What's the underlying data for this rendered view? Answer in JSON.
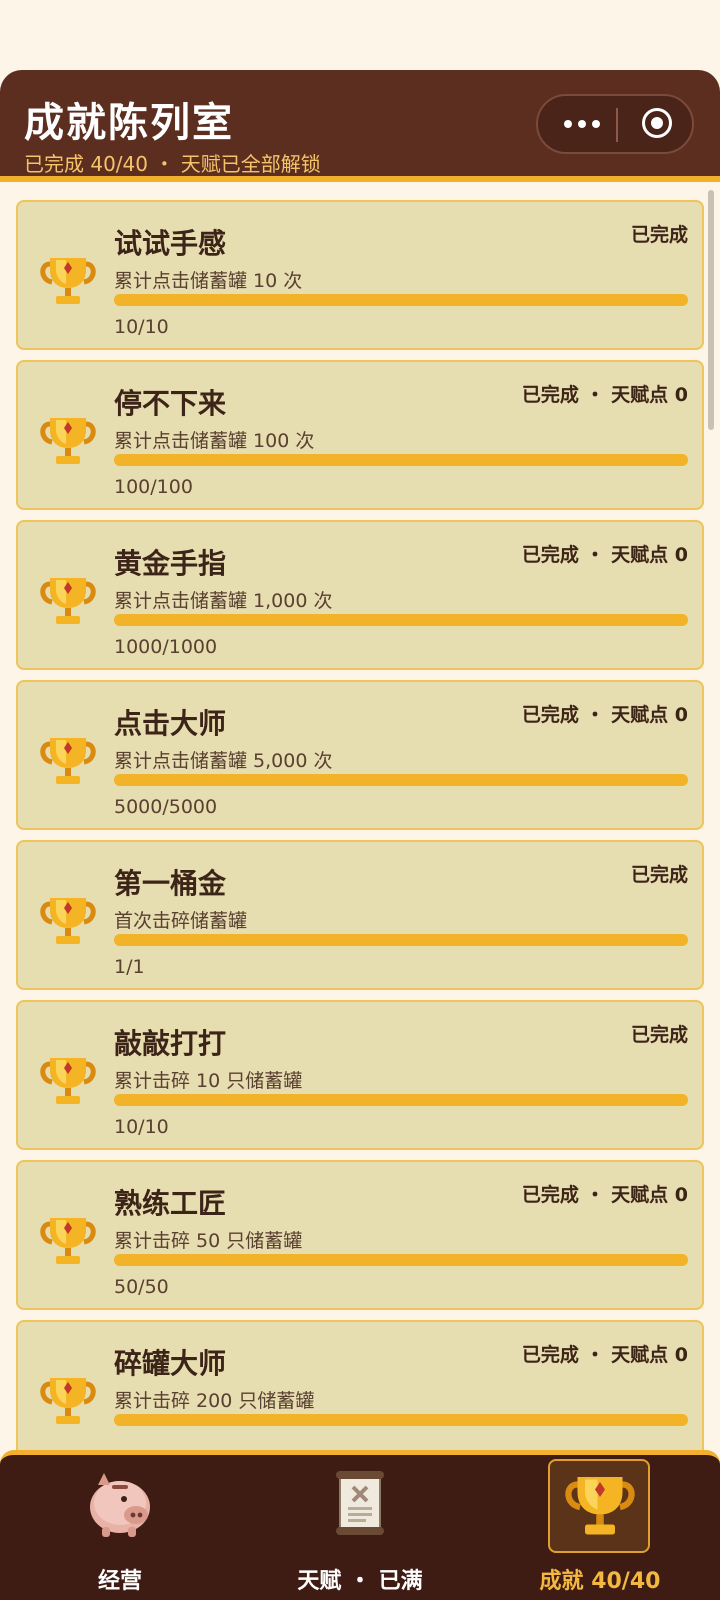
{
  "header": {
    "title": "成就陈列室",
    "subtitle": "已完成 40/40 ・ 天赋已全部解锁"
  },
  "colors": {
    "header_bg": "#5c2e20",
    "accent": "#f2b329",
    "card_bg": "#e6ddb0",
    "tabbar_bg": "#3e1c14"
  },
  "achievements": [
    {
      "title": "试试手感",
      "status": "已完成",
      "desc": "累计点击储蓄罐 10 次",
      "progress": "10/10",
      "fill": 1.0
    },
    {
      "title": "停不下来",
      "status": "已完成 ・ 天赋点 0",
      "desc": "累计点击储蓄罐 100 次",
      "progress": "100/100",
      "fill": 1.0
    },
    {
      "title": "黄金手指",
      "status": "已完成 ・ 天赋点 0",
      "desc": "累计点击储蓄罐 1,000 次",
      "progress": "1000/1000",
      "fill": 1.0
    },
    {
      "title": "点击大师",
      "status": "已完成 ・ 天赋点 0",
      "desc": "累计点击储蓄罐 5,000 次",
      "progress": "5000/5000",
      "fill": 1.0
    },
    {
      "title": "第一桶金",
      "status": "已完成",
      "desc": "首次击碎储蓄罐",
      "progress": "1/1",
      "fill": 1.0
    },
    {
      "title": "敲敲打打",
      "status": "已完成",
      "desc": "累计击碎 10 只储蓄罐",
      "progress": "10/10",
      "fill": 1.0
    },
    {
      "title": "熟练工匠",
      "status": "已完成 ・ 天赋点 0",
      "desc": "累计击碎 50 只储蓄罐",
      "progress": "50/50",
      "fill": 1.0
    },
    {
      "title": "碎罐大师",
      "status": "已完成 ・ 天赋点 0",
      "desc": "累计击碎 200 只储蓄罐",
      "progress": "",
      "fill": 1.0
    }
  ],
  "tabs": [
    {
      "label": "经营",
      "icon": "piggy-bank-icon",
      "active": false
    },
    {
      "label": "天赋 ・ 已满",
      "icon": "scroll-icon",
      "active": false
    },
    {
      "label": "成就 40/40",
      "icon": "trophy-icon",
      "active": true
    }
  ]
}
